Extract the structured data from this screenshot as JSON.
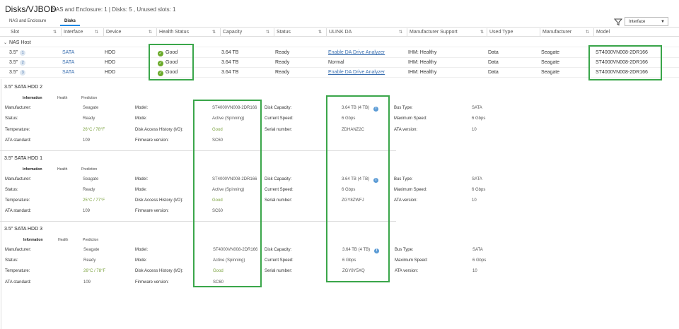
{
  "header": {
    "title": "Disks/VJBOD",
    "subtitle": "NAS and Enclosure: 1 | Disks: 5 , Unused slots: 1"
  },
  "tabs": [
    {
      "label": "NAS and Enclosure"
    },
    {
      "label": "Disks"
    }
  ],
  "filter": {
    "icon": "filter-icon",
    "select_value": "Interface"
  },
  "columns": [
    "Slot",
    "Interface",
    "Device",
    "Health Status",
    "Capacity",
    "Status",
    "ULINK DA",
    "Manufacturer Support",
    "Used Type",
    "Manufacturer",
    "Model"
  ],
  "group": {
    "label": "NAS Host"
  },
  "rows": [
    {
      "slot": "3.5\"",
      "slot_num": "1",
      "interface": "SATA",
      "device": "HDD",
      "health": "Good",
      "capacity": "3.64 TB",
      "status": "Ready",
      "ulink": "Enable DA Drive Analyzer",
      "support": "IHM: Healthy",
      "used_type": "Data",
      "manufacturer": "Seagate",
      "model": "ST4000VN008-2DR166"
    },
    {
      "slot": "3.5\"",
      "slot_num": "2",
      "interface": "SATA",
      "device": "HDD",
      "health": "Good",
      "capacity": "3.64 TB",
      "status": "Ready",
      "ulink": "Normal",
      "support": "IHM: Healthy",
      "used_type": "Data",
      "manufacturer": "Seagate",
      "model": "ST4000VN008-2DR166"
    },
    {
      "slot": "3.5\"",
      "slot_num": "3",
      "interface": "SATA",
      "device": "HDD",
      "health": "Good",
      "capacity": "3.64 TB",
      "status": "Ready",
      "ulink": "Enable DA Drive Analyzer",
      "support": "IHM: Healthy",
      "used_type": "Data",
      "manufacturer": "Seagate",
      "model": "ST4000VN008-2DR166"
    }
  ],
  "detail_tabs": [
    "Information",
    "Health",
    "Prediction"
  ],
  "labels": {
    "manufacturer": "Manufacturer:",
    "status": "Status:",
    "temperature": "Temperature:",
    "ata_standard": "ATA standard:",
    "model": "Model:",
    "mode": "Mode:",
    "disk_access": "Disk Access History (I/O):",
    "firmware": "Firmware version:",
    "disk_capacity": "Disk Capacity:",
    "current_speed": "Current Speed:",
    "serial": "Serial number:",
    "bus_type": "Bus Type:",
    "max_speed": "Maximum Speed:",
    "ata_version": "ATA version:"
  },
  "details": [
    {
      "title": "3.5\" SATA HDD 2",
      "manufacturer": "Seagate",
      "status": "Ready",
      "temperature": "26°C / 78°F",
      "ata_standard": "109",
      "model": "ST4000VN008-2DR166",
      "mode": "Active (Spinning)",
      "disk_access": "Good",
      "firmware": "SC60",
      "capacity": "3.64 TB (4 TB)",
      "current_speed": "6 Gbps",
      "serial": "ZDHANZ2C",
      "bus_type": "SATA",
      "max_speed": "6 Gbps",
      "ata_version": "10"
    },
    {
      "title": "3.5\" SATA HDD 1",
      "manufacturer": "Seagate",
      "status": "Ready",
      "temperature": "25°C / 77°F",
      "ata_standard": "109",
      "model": "ST4000VN008-2DR166",
      "mode": "Active (Spinning)",
      "disk_access": "Good",
      "firmware": "SC60",
      "capacity": "3.64 TB (4 TB)",
      "current_speed": "6 Gbps",
      "serial": "ZGY8ZWFJ",
      "bus_type": "SATA",
      "max_speed": "6 Gbps",
      "ata_version": "10"
    },
    {
      "title": "3.5\" SATA HDD 3",
      "manufacturer": "Seagate",
      "status": "Ready",
      "temperature": "26°C / 78°F",
      "ata_standard": "109",
      "model": "ST4000VN008-2DR166",
      "mode": "Active (Spinning)",
      "disk_access": "Good",
      "firmware": "SC60",
      "capacity": "3.64 TB (4 TB)",
      "current_speed": "6 Gbps",
      "serial": "ZGY8Y5XQ",
      "bus_type": "SATA",
      "max_speed": "6 Gbps",
      "ata_version": "10"
    }
  ],
  "colors": {
    "accent": "#1e88e5",
    "good": "#6aaa2a",
    "highlight": "#3aa64a",
    "link": "#3a6fb0"
  }
}
